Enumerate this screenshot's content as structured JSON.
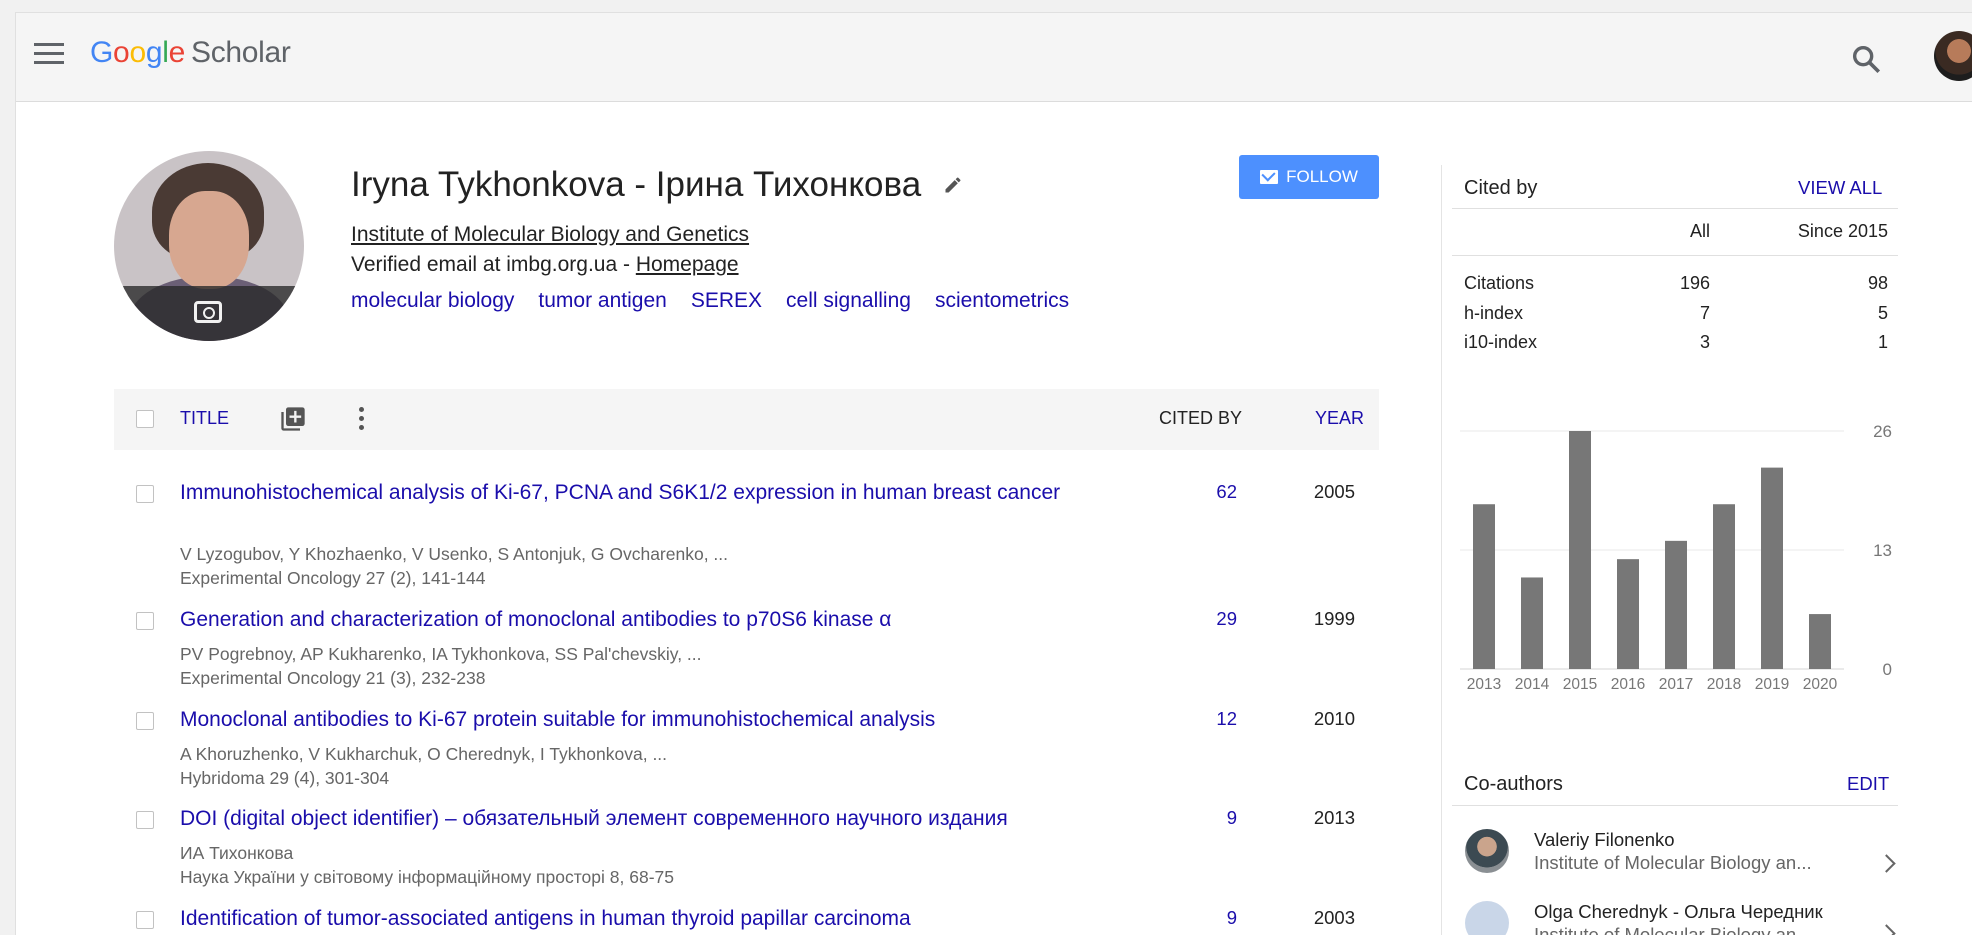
{
  "header": {
    "logo_parts": [
      "G",
      "o",
      "o",
      "g",
      "l",
      "e"
    ],
    "logo_scholar": "Scholar"
  },
  "profile": {
    "name": "Iryna Tykhonkova - Ірина Тихонкова",
    "affiliation": "Institute of Molecular Biology and Genetics",
    "email_prefix": "Verified email at imbg.org.ua - ",
    "homepage": "Homepage",
    "interests": [
      "molecular biology",
      "tumor antigen",
      "SEREX",
      "cell signalling",
      "scientometrics"
    ],
    "follow_label": "FOLLOW"
  },
  "table": {
    "col_title": "TITLE",
    "col_cited": "CITED BY",
    "col_year": "YEAR",
    "rows": [
      {
        "title": "Immunohistochemical analysis of Ki-67, PCNA and S6K1/2 expression in human breast cancer",
        "authors": "V Lyzogubov, Y Khozhaenko, V Usenko, S Antonjuk, G Ovcharenko, ...",
        "venue": "Experimental Oncology 27 (2), 141-144",
        "cited": "62",
        "year": "2005"
      },
      {
        "title": "Generation and characterization of monoclonal antibodies to p70S6 kinase α",
        "authors": "PV Pogrebnoy, AP Kukharenko, IA Tykhonkova, SS Pal'chevskiy, ...",
        "venue": "Experimental Oncology 21 (3), 232-238",
        "cited": "29",
        "year": "1999"
      },
      {
        "title": "Monoclonal antibodies to Ki-67 protein suitable for immunohistochemical analysis",
        "authors": "A Khoruzhenko, V Kukharchuk, O Cherednyk, I Tykhonkova, ...",
        "venue": "Hybridoma 29 (4), 301-304",
        "cited": "12",
        "year": "2010"
      },
      {
        "title": "DOI (digital object identifier) – обязательный элемент современного научного издания",
        "authors": "ИА Тихонкова",
        "venue": "Наука України у світовому інформаційному просторі 8, 68-75",
        "cited": "9",
        "year": "2013"
      },
      {
        "title": "Identification of tumor-associated antigens in human thyroid papillar carcinoma",
        "authors": "",
        "venue": "",
        "cited": "9",
        "year": "2003"
      }
    ]
  },
  "cited_by": {
    "title": "Cited by",
    "view_all": "VIEW ALL",
    "col_all": "All",
    "col_since": "Since 2015",
    "stats": [
      {
        "label": "Citations",
        "all": "196",
        "since": "98"
      },
      {
        "label": "h-index",
        "all": "7",
        "since": "5"
      },
      {
        "label": "i10-index",
        "all": "3",
        "since": "1"
      }
    ]
  },
  "chart_data": {
    "type": "bar",
    "categories": [
      "2013",
      "2014",
      "2015",
      "2016",
      "2017",
      "2018",
      "2019",
      "2020"
    ],
    "values": [
      18,
      10,
      26,
      12,
      14,
      18,
      22,
      6
    ],
    "ylim": [
      0,
      26
    ],
    "yticks": [
      "26",
      "13",
      "0"
    ],
    "grid": true,
    "bar_color": "#777777"
  },
  "coauthors": {
    "title": "Co-authors",
    "edit": "EDIT",
    "list": [
      {
        "name": "Valeriy Filonenko",
        "affiliation": "Institute of Molecular Biology an..."
      },
      {
        "name": "Olga Cherednyk - Ольга Чередник",
        "affiliation": "Institute of Molecular Biology an..."
      }
    ]
  },
  "colors": {
    "link": "#1a0dab",
    "follow": "#4d90fe"
  }
}
